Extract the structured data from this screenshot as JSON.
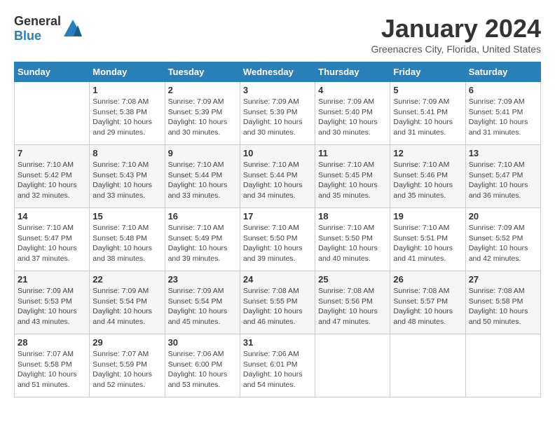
{
  "header": {
    "logo_general": "General",
    "logo_blue": "Blue",
    "month_title": "January 2024",
    "subtitle": "Greenacres City, Florida, United States"
  },
  "days_of_week": [
    "Sunday",
    "Monday",
    "Tuesday",
    "Wednesday",
    "Thursday",
    "Friday",
    "Saturday"
  ],
  "weeks": [
    [
      {
        "day": "",
        "info": ""
      },
      {
        "day": "1",
        "info": "Sunrise: 7:08 AM\nSunset: 5:38 PM\nDaylight: 10 hours\nand 29 minutes."
      },
      {
        "day": "2",
        "info": "Sunrise: 7:09 AM\nSunset: 5:39 PM\nDaylight: 10 hours\nand 30 minutes."
      },
      {
        "day": "3",
        "info": "Sunrise: 7:09 AM\nSunset: 5:39 PM\nDaylight: 10 hours\nand 30 minutes."
      },
      {
        "day": "4",
        "info": "Sunrise: 7:09 AM\nSunset: 5:40 PM\nDaylight: 10 hours\nand 30 minutes."
      },
      {
        "day": "5",
        "info": "Sunrise: 7:09 AM\nSunset: 5:41 PM\nDaylight: 10 hours\nand 31 minutes."
      },
      {
        "day": "6",
        "info": "Sunrise: 7:09 AM\nSunset: 5:41 PM\nDaylight: 10 hours\nand 31 minutes."
      }
    ],
    [
      {
        "day": "7",
        "info": "Sunrise: 7:10 AM\nSunset: 5:42 PM\nDaylight: 10 hours\nand 32 minutes."
      },
      {
        "day": "8",
        "info": "Sunrise: 7:10 AM\nSunset: 5:43 PM\nDaylight: 10 hours\nand 33 minutes."
      },
      {
        "day": "9",
        "info": "Sunrise: 7:10 AM\nSunset: 5:44 PM\nDaylight: 10 hours\nand 33 minutes."
      },
      {
        "day": "10",
        "info": "Sunrise: 7:10 AM\nSunset: 5:44 PM\nDaylight: 10 hours\nand 34 minutes."
      },
      {
        "day": "11",
        "info": "Sunrise: 7:10 AM\nSunset: 5:45 PM\nDaylight: 10 hours\nand 35 minutes."
      },
      {
        "day": "12",
        "info": "Sunrise: 7:10 AM\nSunset: 5:46 PM\nDaylight: 10 hours\nand 35 minutes."
      },
      {
        "day": "13",
        "info": "Sunrise: 7:10 AM\nSunset: 5:47 PM\nDaylight: 10 hours\nand 36 minutes."
      }
    ],
    [
      {
        "day": "14",
        "info": "Sunrise: 7:10 AM\nSunset: 5:47 PM\nDaylight: 10 hours\nand 37 minutes."
      },
      {
        "day": "15",
        "info": "Sunrise: 7:10 AM\nSunset: 5:48 PM\nDaylight: 10 hours\nand 38 minutes."
      },
      {
        "day": "16",
        "info": "Sunrise: 7:10 AM\nSunset: 5:49 PM\nDaylight: 10 hours\nand 39 minutes."
      },
      {
        "day": "17",
        "info": "Sunrise: 7:10 AM\nSunset: 5:50 PM\nDaylight: 10 hours\nand 39 minutes."
      },
      {
        "day": "18",
        "info": "Sunrise: 7:10 AM\nSunset: 5:50 PM\nDaylight: 10 hours\nand 40 minutes."
      },
      {
        "day": "19",
        "info": "Sunrise: 7:10 AM\nSunset: 5:51 PM\nDaylight: 10 hours\nand 41 minutes."
      },
      {
        "day": "20",
        "info": "Sunrise: 7:09 AM\nSunset: 5:52 PM\nDaylight: 10 hours\nand 42 minutes."
      }
    ],
    [
      {
        "day": "21",
        "info": "Sunrise: 7:09 AM\nSunset: 5:53 PM\nDaylight: 10 hours\nand 43 minutes."
      },
      {
        "day": "22",
        "info": "Sunrise: 7:09 AM\nSunset: 5:54 PM\nDaylight: 10 hours\nand 44 minutes."
      },
      {
        "day": "23",
        "info": "Sunrise: 7:09 AM\nSunset: 5:54 PM\nDaylight: 10 hours\nand 45 minutes."
      },
      {
        "day": "24",
        "info": "Sunrise: 7:08 AM\nSunset: 5:55 PM\nDaylight: 10 hours\nand 46 minutes."
      },
      {
        "day": "25",
        "info": "Sunrise: 7:08 AM\nSunset: 5:56 PM\nDaylight: 10 hours\nand 47 minutes."
      },
      {
        "day": "26",
        "info": "Sunrise: 7:08 AM\nSunset: 5:57 PM\nDaylight: 10 hours\nand 48 minutes."
      },
      {
        "day": "27",
        "info": "Sunrise: 7:08 AM\nSunset: 5:58 PM\nDaylight: 10 hours\nand 50 minutes."
      }
    ],
    [
      {
        "day": "28",
        "info": "Sunrise: 7:07 AM\nSunset: 5:58 PM\nDaylight: 10 hours\nand 51 minutes."
      },
      {
        "day": "29",
        "info": "Sunrise: 7:07 AM\nSunset: 5:59 PM\nDaylight: 10 hours\nand 52 minutes."
      },
      {
        "day": "30",
        "info": "Sunrise: 7:06 AM\nSunset: 6:00 PM\nDaylight: 10 hours\nand 53 minutes."
      },
      {
        "day": "31",
        "info": "Sunrise: 7:06 AM\nSunset: 6:01 PM\nDaylight: 10 hours\nand 54 minutes."
      },
      {
        "day": "",
        "info": ""
      },
      {
        "day": "",
        "info": ""
      },
      {
        "day": "",
        "info": ""
      }
    ]
  ]
}
